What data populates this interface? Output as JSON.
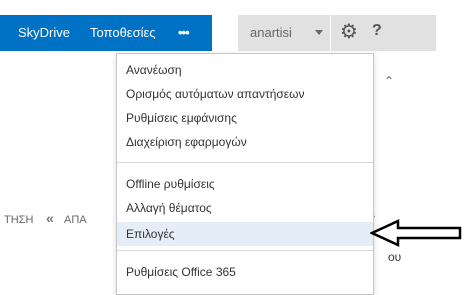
{
  "topbar": {
    "nav": [
      "SkyDrive",
      "Τοποθεσίες",
      "•••"
    ],
    "user": "anartisi",
    "gear_icon": "gear-icon",
    "help": "?"
  },
  "menu": {
    "items": [
      "Ανανέωση",
      "Ορισμός αυτόματων απαντήσεων",
      "Ρυθμίσεις εμφάνισης",
      "Διαχείριση εφαρμογών",
      "Offline ρυθμίσεις",
      "Αλλαγή θέματος",
      "Επιλογές",
      "Ρυθμίσεις Office 365"
    ],
    "highlighted": "Επιλογές"
  },
  "background": {
    "left_text": "ΤΗΣΗ",
    "left_arrow": "«",
    "left_text2": "ΑΠΑ",
    "right_text": "ου",
    "dots": "••",
    "chevron": "«"
  }
}
